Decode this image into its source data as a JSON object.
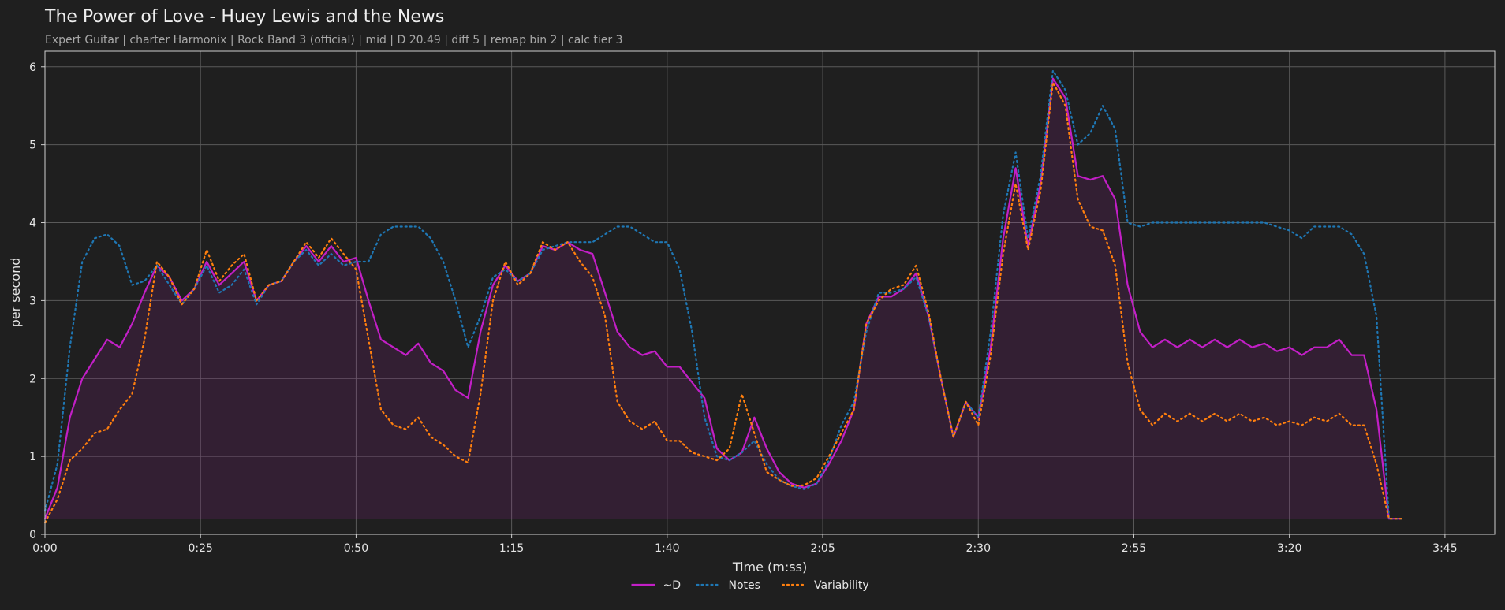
{
  "chart_data": {
    "type": "line",
    "title": "The Power of Love - Huey Lewis and the News",
    "subtitle": "Expert Guitar  |  charter Harmonix  |  Rock Band 3 (official)  |  mid  |  D 20.49  |  diff 5  |  remap bin 2  |  calc tier 3",
    "xlabel": "Time (m:ss)",
    "ylabel": "per second",
    "xlim": [
      0,
      233
    ],
    "ylim": [
      0,
      6.2
    ],
    "x_ticks": [
      0,
      25,
      50,
      75,
      100,
      125,
      150,
      175,
      200,
      225
    ],
    "x_tick_labels": [
      "0:00",
      "0:25",
      "0:50",
      "1:15",
      "1:40",
      "2:05",
      "2:30",
      "2:55",
      "3:20",
      "3:45"
    ],
    "y_ticks": [
      0,
      1,
      2,
      3,
      4,
      5,
      6
    ],
    "y_tick_labels": [
      "0",
      "1",
      "2",
      "3",
      "4",
      "5",
      "6"
    ],
    "grid": true,
    "legend_position": "bottom-center",
    "x": [
      0,
      2,
      4,
      6,
      8,
      10,
      12,
      14,
      16,
      18,
      20,
      22,
      24,
      26,
      28,
      30,
      32,
      34,
      36,
      38,
      40,
      42,
      44,
      46,
      48,
      50,
      52,
      54,
      56,
      58,
      60,
      62,
      64,
      66,
      68,
      70,
      72,
      74,
      76,
      78,
      80,
      82,
      84,
      86,
      88,
      90,
      92,
      94,
      96,
      98,
      100,
      102,
      104,
      106,
      108,
      110,
      112,
      114,
      116,
      118,
      120,
      122,
      124,
      126,
      128,
      130,
      132,
      134,
      136,
      138,
      140,
      142,
      144,
      146,
      148,
      150,
      152,
      154,
      156,
      158,
      160,
      162,
      164,
      166,
      168,
      170,
      172,
      174,
      176,
      178,
      180,
      182,
      184,
      186,
      188,
      190,
      192,
      194,
      196,
      198,
      200,
      202,
      204,
      206,
      208,
      210,
      212,
      214,
      216,
      218,
      220,
      222,
      224,
      226,
      228,
      230,
      232,
      233
    ],
    "series": [
      {
        "name": "~D",
        "color": "#c21fc6",
        "style": "solid",
        "fill": true,
        "values": [
          0.2,
          0.6,
          1.5,
          2.0,
          2.25,
          2.5,
          2.4,
          2.7,
          3.1,
          3.45,
          3.3,
          3.0,
          3.15,
          3.5,
          3.2,
          3.35,
          3.5,
          3.0,
          3.2,
          3.25,
          3.5,
          3.7,
          3.5,
          3.7,
          3.5,
          3.55,
          3.0,
          2.5,
          2.4,
          2.3,
          2.45,
          2.2,
          2.1,
          1.85,
          1.75,
          2.6,
          3.2,
          3.45,
          3.25,
          3.35,
          3.7,
          3.65,
          3.75,
          3.65,
          3.6,
          3.1,
          2.6,
          2.4,
          2.3,
          2.35,
          2.15,
          2.15,
          1.95,
          1.75,
          1.1,
          0.95,
          1.05,
          1.5,
          1.1,
          0.8,
          0.65,
          0.6,
          0.65,
          0.9,
          1.2,
          1.6,
          2.7,
          3.05,
          3.05,
          3.15,
          3.35,
          2.8,
          2.0,
          1.25,
          1.7,
          1.5,
          2.4,
          3.8,
          4.7,
          3.7,
          4.5,
          5.85,
          5.6,
          4.6,
          4.55,
          4.6,
          4.3,
          3.2,
          2.6,
          2.4,
          2.5,
          2.4,
          2.5,
          2.4,
          2.5,
          2.4,
          2.5,
          2.4,
          2.45,
          2.35,
          2.4,
          2.3,
          2.4,
          2.4,
          2.5,
          2.3,
          2.3,
          1.6,
          0.2,
          0.2
        ]
      },
      {
        "name": "Notes",
        "color": "#1f77b4",
        "style": "dotted",
        "fill": false,
        "values": [
          0.3,
          0.9,
          2.4,
          3.5,
          3.8,
          3.85,
          3.7,
          3.2,
          3.25,
          3.45,
          3.2,
          2.95,
          3.15,
          3.45,
          3.1,
          3.2,
          3.4,
          2.95,
          3.2,
          3.25,
          3.5,
          3.65,
          3.45,
          3.6,
          3.45,
          3.5,
          3.5,
          3.85,
          3.95,
          3.95,
          3.95,
          3.8,
          3.5,
          3.0,
          2.4,
          2.8,
          3.3,
          3.4,
          3.25,
          3.35,
          3.65,
          3.7,
          3.75,
          3.75,
          3.75,
          3.85,
          3.95,
          3.95,
          3.85,
          3.75,
          3.75,
          3.4,
          2.6,
          1.5,
          1.0,
          0.95,
          1.05,
          1.2,
          0.9,
          0.7,
          0.62,
          0.58,
          0.65,
          0.95,
          1.4,
          1.7,
          2.6,
          3.1,
          3.1,
          3.15,
          3.3,
          2.8,
          2.0,
          1.25,
          1.7,
          1.5,
          2.6,
          4.1,
          4.9,
          3.8,
          4.6,
          5.95,
          5.7,
          5.0,
          5.15,
          5.5,
          5.2,
          4.0,
          3.95,
          4.0,
          4.0,
          4.0,
          4.0,
          4.0,
          4.0,
          4.0,
          4.0,
          4.0,
          4.0,
          3.95,
          3.9,
          3.8,
          3.95,
          3.95,
          3.95,
          3.85,
          3.6,
          2.8,
          0.2,
          0.2
        ]
      },
      {
        "name": "Variability",
        "color": "#ff7f0e",
        "style": "dotted",
        "fill": false,
        "values": [
          0.15,
          0.45,
          0.95,
          1.1,
          1.3,
          1.35,
          1.6,
          1.8,
          2.5,
          3.5,
          3.3,
          2.95,
          3.15,
          3.65,
          3.25,
          3.45,
          3.6,
          3.0,
          3.2,
          3.25,
          3.5,
          3.75,
          3.55,
          3.8,
          3.6,
          3.4,
          2.5,
          1.6,
          1.4,
          1.35,
          1.5,
          1.25,
          1.15,
          1.0,
          0.92,
          1.8,
          3.0,
          3.5,
          3.2,
          3.35,
          3.75,
          3.65,
          3.75,
          3.5,
          3.3,
          2.8,
          1.7,
          1.45,
          1.35,
          1.45,
          1.2,
          1.2,
          1.05,
          1.0,
          0.95,
          1.1,
          1.8,
          1.3,
          0.8,
          0.7,
          0.62,
          0.63,
          0.72,
          1.0,
          1.3,
          1.6,
          2.7,
          3.0,
          3.15,
          3.2,
          3.45,
          2.85,
          2.0,
          1.25,
          1.7,
          1.4,
          2.3,
          3.6,
          4.5,
          3.65,
          4.4,
          5.8,
          5.5,
          4.3,
          3.95,
          3.9,
          3.45,
          2.2,
          1.6,
          1.4,
          1.55,
          1.45,
          1.55,
          1.45,
          1.55,
          1.45,
          1.55,
          1.45,
          1.5,
          1.4,
          1.45,
          1.4,
          1.5,
          1.45,
          1.55,
          1.4,
          1.4,
          0.9,
          0.2,
          0.2
        ]
      }
    ]
  }
}
